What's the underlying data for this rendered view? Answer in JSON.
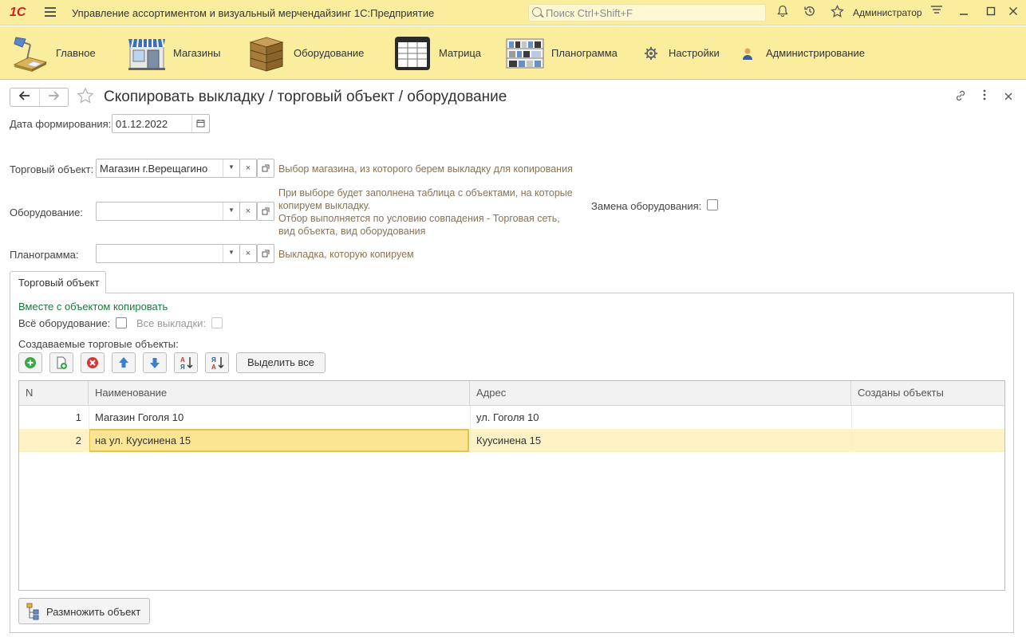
{
  "titlebar": {
    "logo": "1С",
    "app_title": "Управление ассортиментом  и визуальный мерчендайзинг 1С:Предприятие",
    "search_placeholder": "Поиск Ctrl+Shift+F",
    "user": "Администратор",
    "icons": [
      "bell-icon",
      "history-icon",
      "star-icon",
      "settings-lines-icon",
      "minimize-icon",
      "maximize-icon",
      "close-icon"
    ]
  },
  "sections": [
    {
      "label": "Главное",
      "icon": "desk-lamp-icon"
    },
    {
      "label": "Магазины",
      "icon": "shop-icon"
    },
    {
      "label": "Оборудование",
      "icon": "boxes-icon"
    },
    {
      "label": "Матрица",
      "icon": "table-icon"
    },
    {
      "label": "Планограмма",
      "icon": "planogram-icon"
    },
    {
      "label": "Настройки",
      "icon": "gear-icon"
    },
    {
      "label": "Администрирование",
      "icon": "user-icon"
    }
  ],
  "form": {
    "title": "Скопировать выкладку / торговый объект / оборудование",
    "date_label": "Дата формирования:",
    "date_value": "01.12.2022",
    "shop_label": "Торговый объект:",
    "shop_value": "Магазин г.Верещагино",
    "shop_hint": "Выбор магазина, из которого берем выкладку для копирования",
    "equipment_label": "Оборудование:",
    "equipment_value": "",
    "equipment_hint_1": "При выборе будет заполнена таблица с объектами, на которые",
    "equipment_hint_2": "копируем выкладку.",
    "equipment_hint_3": "Отбор выполняется по условию совпадения - Торговая сеть,",
    "equipment_hint_4": "вид объекта, вид оборудования",
    "replace_label": "Замена оборудования:",
    "replace_checked": false,
    "planogram_label": "Планограмма:",
    "planogram_value": "",
    "planogram_hint": "Выкладка, которую копируем"
  },
  "tab": {
    "label": "Торговый объект",
    "group_title": "Вместе с объектом копировать",
    "all_equipment_label": "Всё оборудование:",
    "all_equipment_checked": false,
    "all_layouts_label": "Все выкладки:",
    "all_layouts_checked": false,
    "created_label": "Создаваемые торговые объекты:",
    "select_all_label": "Выделить все",
    "multiply_label": "Размножить объект"
  },
  "table": {
    "columns": [
      "N",
      "Наименование",
      "Адрес",
      "Созданы объекты"
    ],
    "rows": [
      {
        "n": "1",
        "name": "Магазин Гоголя 10",
        "address": "ул. Гоголя 10",
        "created": ""
      },
      {
        "n": "2",
        "name": "на ул. Куусинена 15",
        "address": "Куусинена 15",
        "created": ""
      }
    ],
    "selected_row": 2
  },
  "colors": {
    "titlebar": "#fbed9e",
    "group_title": "#1d7a3a",
    "hint": "#8a7350",
    "selected_row": "#fcf2c6",
    "current_cell": "#fbe592"
  }
}
